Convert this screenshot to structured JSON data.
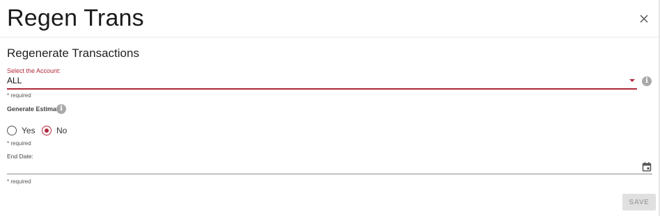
{
  "dialog": {
    "title": "Regen Trans",
    "close_icon": "close-icon"
  },
  "form": {
    "section_title": "Regenerate Transactions",
    "account": {
      "label": "Select the Account:",
      "value": "ALL",
      "hint": "* required",
      "info_icon": "i"
    },
    "estimate": {
      "label": "Generate Estimate:",
      "info_icon": "i",
      "options": [
        {
          "label": "Yes",
          "checked": false
        },
        {
          "label": "No",
          "checked": true
        }
      ],
      "hint": "* required"
    },
    "end_date": {
      "label": "End Date:",
      "value": "",
      "hint": "* required"
    },
    "save_label": "SAVE"
  },
  "colors": {
    "accent": "#b0283a",
    "disabled_button_bg": "#e0e0e0",
    "disabled_button_text": "#a6a6a6"
  }
}
